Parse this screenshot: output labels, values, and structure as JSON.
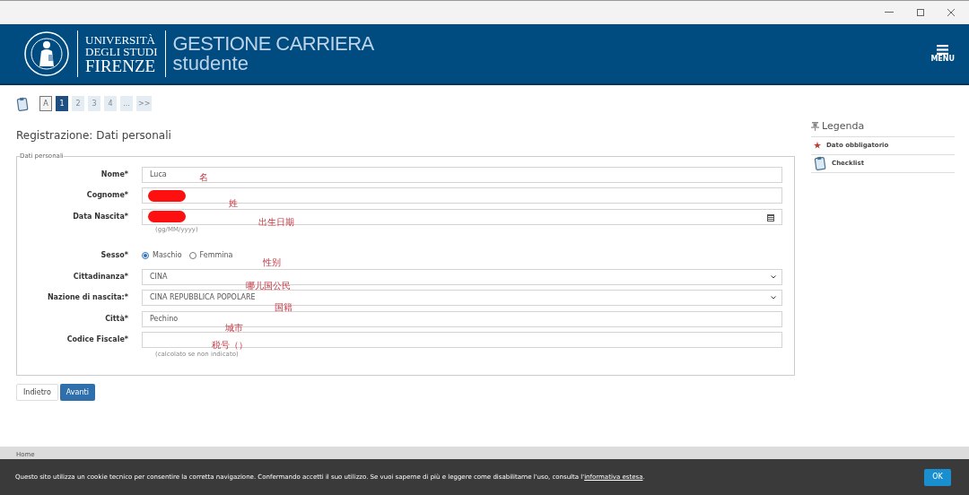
{
  "header": {
    "university": [
      "UNIVERSITÀ",
      "DEGLI STUDI",
      "FIRENZE"
    ],
    "app_title": "GESTIONE CARRIERA",
    "app_subtitle": "studente",
    "menu_label": "MENU"
  },
  "steps": [
    {
      "label": "A",
      "kind": "outline",
      "selected": false
    },
    {
      "label": "1",
      "kind": "step",
      "selected": true
    },
    {
      "label": "2",
      "kind": "step",
      "selected": false
    },
    {
      "label": "3",
      "kind": "step",
      "selected": false
    },
    {
      "label": "4",
      "kind": "step",
      "selected": false
    },
    {
      "label": "...",
      "kind": "step",
      "selected": false
    },
    {
      "label": ">>",
      "kind": "step",
      "selected": false
    }
  ],
  "page_title": "Registrazione: Dati personali",
  "fieldset_legend": "Dati personali",
  "fields": [
    {
      "label": "Nome*",
      "kind": "text",
      "value": "Luca",
      "redacted": false
    },
    {
      "label": "Cognome*",
      "kind": "text",
      "redacted": true
    },
    {
      "label": "Data Nascita*",
      "kind": "date",
      "redacted": true,
      "hint": "(gg/MM/yyyy)"
    },
    {
      "label": "Sesso*",
      "kind": "radio",
      "options": [
        {
          "label": "Maschio",
          "selected": true
        },
        {
          "label": "Femmina",
          "selected": false
        }
      ]
    },
    {
      "label": "Cittadinanza*",
      "kind": "select",
      "value": "CINA"
    },
    {
      "label": "Nazione di nascita:*",
      "kind": "select",
      "value": "CINA REPUBBLICA POPOLARE"
    },
    {
      "label": "Città*",
      "kind": "text",
      "value": "Pechino",
      "redacted": false
    },
    {
      "label": "Codice Fiscale*",
      "kind": "text",
      "redacted": false,
      "hint": "(calcolato se non indicato)"
    }
  ],
  "buttons": [
    {
      "label": "Indietro",
      "kind": "secondary"
    },
    {
      "label": "Avanti",
      "kind": "primary"
    }
  ],
  "legend": {
    "title": "Legenda",
    "items": [
      {
        "label": "Dato obbligatorio",
        "kind": "star"
      },
      {
        "label": "Checklist",
        "kind": "clipboard"
      }
    ]
  },
  "annotations": [
    "名",
    "姓",
    "出生日期",
    "性别",
    "哪儿国公民",
    "国籍",
    "城市",
    "税号（）"
  ],
  "footer": {
    "breadcrumb": "Home",
    "cookie_text": "Questo sito utilizza un cookie tecnico per consentire la corretta navigazione. Confermando accetti il suo utilizzo. Se vuoi saperne di più e leggere come disabilitarne l'uso, consulta l'",
    "cookie_link": "informativa estesa",
    "cookie_end": ".",
    "ok": "OK"
  }
}
